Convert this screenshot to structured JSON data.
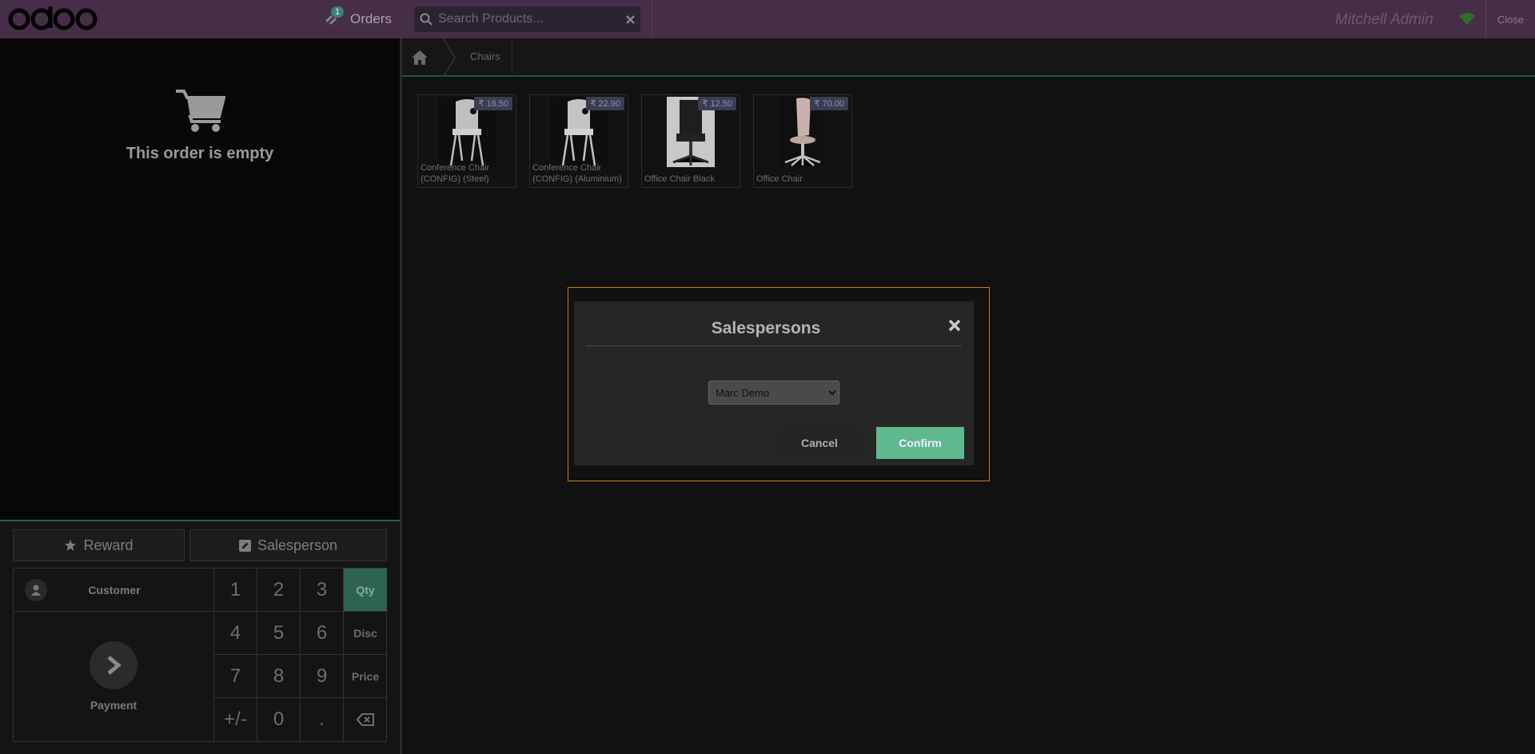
{
  "topbar": {
    "logo_text": "odoo",
    "orders_label": "Orders",
    "orders_count": "1",
    "search_placeholder": "Search Products...",
    "username": "Mitchell Admin",
    "close_label": "Close"
  },
  "order": {
    "empty_message": "This order is empty"
  },
  "controls": {
    "reward_label": "Reward",
    "salesperson_label": "Salesperson",
    "customer_label": "Customer",
    "payment_label": "Payment",
    "keys": [
      "1",
      "2",
      "3",
      "4",
      "5",
      "6",
      "7",
      "8",
      "9",
      "+/-",
      "0",
      "."
    ],
    "modes": [
      "Qty",
      "Disc",
      "Price"
    ],
    "active_mode": "Qty"
  },
  "breadcrumb": {
    "category": "Chairs"
  },
  "products": [
    {
      "name": "Conference Chair (CONFIG) (Steel)",
      "price": "₹ 16.50"
    },
    {
      "name": "Conference Chair (CONFIG) (Aluminium)",
      "price": "₹ 22.90"
    },
    {
      "name": "Office Chair Black",
      "price": "₹ 12.50"
    },
    {
      "name": "Office Chair",
      "price": "₹ 70.00"
    }
  ],
  "modal": {
    "title": "Salespersons",
    "selected": "Marc Demo",
    "cancel_label": "Cancel",
    "confirm_label": "Confirm"
  },
  "colors": {
    "topbar": "#462d48",
    "accent_green": "#5fb88e",
    "modal_border": "#c07f1b"
  }
}
